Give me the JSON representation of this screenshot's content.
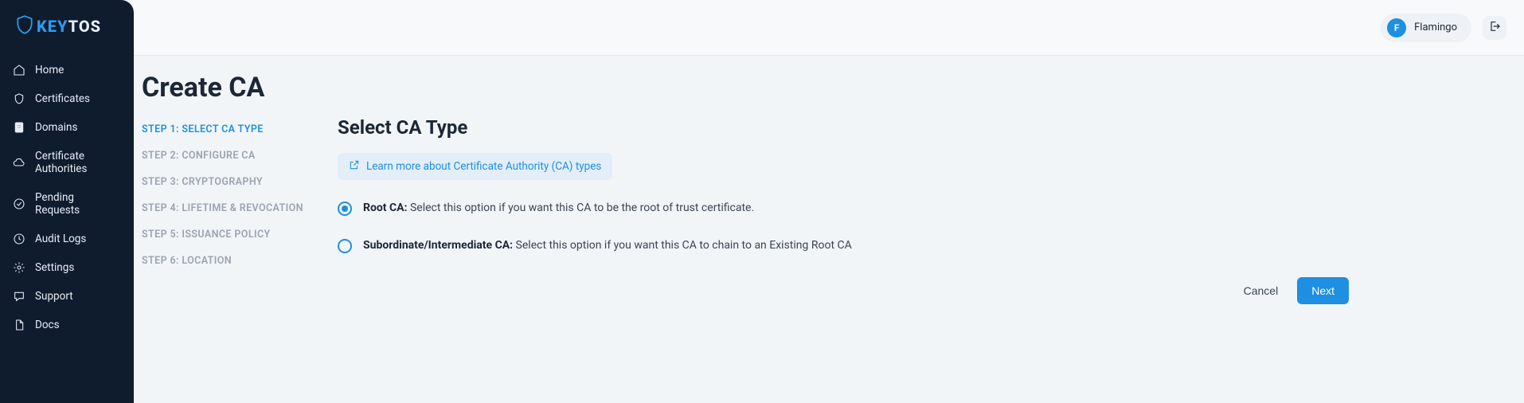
{
  "brand": {
    "name_k": "KEY",
    "name_rest": "TOS"
  },
  "sidebar": {
    "items": [
      {
        "label": "Home"
      },
      {
        "label": "Certificates"
      },
      {
        "label": "Domains"
      },
      {
        "label": "Certificate Authorities"
      },
      {
        "label": "Pending Requests"
      },
      {
        "label": "Audit Logs"
      },
      {
        "label": "Settings"
      },
      {
        "label": "Support"
      },
      {
        "label": "Docs"
      }
    ]
  },
  "topbar": {
    "user_initial": "F",
    "user_name": "Flamingo"
  },
  "page": {
    "title": "Create CA",
    "steps": [
      {
        "label": "STEP 1: SELECT CA TYPE",
        "active": true
      },
      {
        "label": "STEP 2: CONFIGURE CA",
        "active": false
      },
      {
        "label": "STEP 3: CRYPTOGRAPHY",
        "active": false
      },
      {
        "label": "STEP 4: LIFETIME & REVOCATION",
        "active": false
      },
      {
        "label": "STEP 5: ISSUANCE POLICY",
        "active": false
      },
      {
        "label": "STEP 6: LOCATION",
        "active": false
      }
    ],
    "panel_title": "Select CA Type",
    "learn_more": "Learn more about Certificate Authority (CA) types",
    "options": [
      {
        "title": "Root CA:",
        "desc": " Select this option if you want this CA to be the root of trust certificate.",
        "selected": true
      },
      {
        "title": "Subordinate/Intermediate CA:",
        "desc": " Select this option if you want this CA to chain to an Existing Root CA",
        "selected": false
      }
    ],
    "cancel": "Cancel",
    "next": "Next"
  }
}
